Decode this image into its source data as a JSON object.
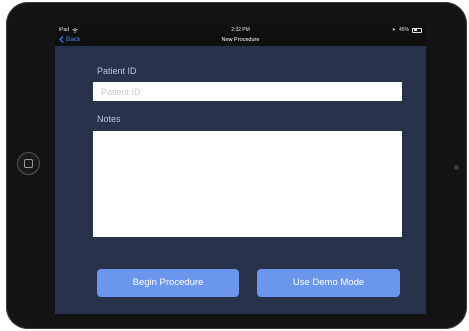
{
  "status_bar": {
    "device": "iPad",
    "wifi_icon": "wifi-icon",
    "time": "2:32 PM",
    "battery_percent": "45%",
    "battery_level": 0.45
  },
  "nav": {
    "back_label": "Back",
    "title": "New Procedure"
  },
  "form": {
    "patient_id_label": "Patient ID",
    "patient_id_placeholder": "Patient ID",
    "patient_id_value": "",
    "notes_label": "Notes",
    "notes_value": ""
  },
  "actions": {
    "begin_label": "Begin Procedure",
    "demo_label": "Use Demo Mode"
  },
  "colors": {
    "content_bg": "#28324b",
    "button": "#6a97ec",
    "back_link": "#3d8bff"
  }
}
